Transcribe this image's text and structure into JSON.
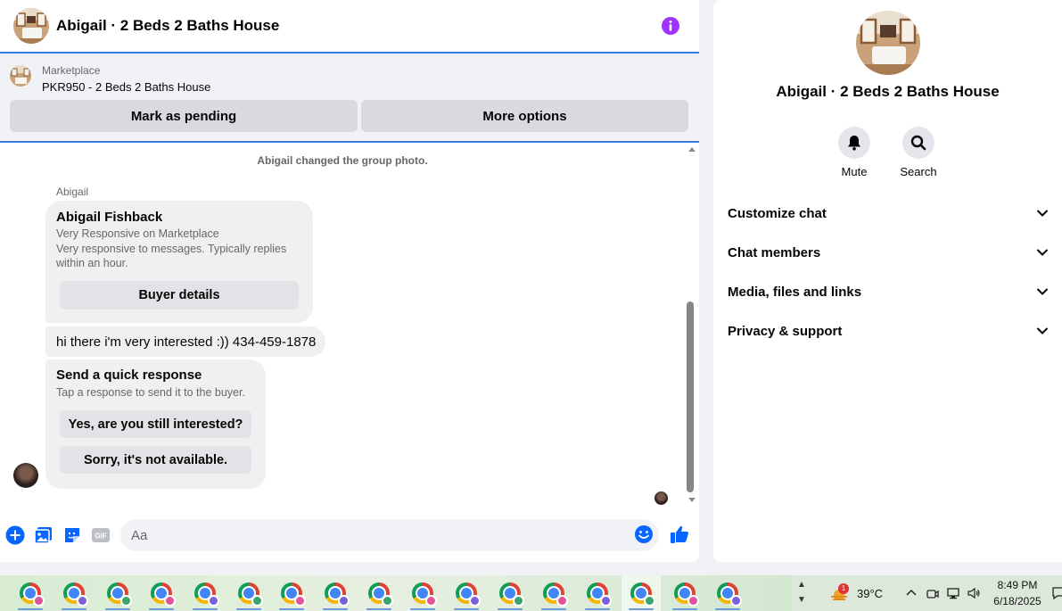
{
  "chat": {
    "title": "Abigail · 2 Beds 2 Baths House",
    "marketplace": {
      "label": "Marketplace",
      "item": "PKR950 - 2 Beds 2 Baths House",
      "mark_pending": "Mark as pending",
      "more_options": "More options"
    },
    "messages": {
      "system_note": "Abigail changed the group photo.",
      "sender": "Abigail",
      "profile_card": {
        "name": "Abigail Fishback",
        "line1": "Very Responsive on Marketplace",
        "line2": "Very responsive to messages. Typically replies within an hour.",
        "button": "Buyer details"
      },
      "text": "hi there i'm very interested :)) 434-459-1878",
      "quick_response": {
        "title": "Send a quick response",
        "subtitle": "Tap a response to send it to the buyer.",
        "option1": "Yes, are you still interested?",
        "option2": "Sorry, it's not available."
      }
    },
    "composer": {
      "placeholder": "Aa",
      "icons": [
        "plus-icon",
        "photo-icon",
        "sticker-icon",
        "gif-icon",
        "emoji-icon",
        "like-icon"
      ]
    },
    "accent_color": "#0866ff",
    "info_icon_color": "#a033ff"
  },
  "info_panel": {
    "title": "Abigail · 2 Beds 2 Baths House",
    "actions": {
      "mute": "Mute",
      "search": "Search"
    },
    "sections": [
      "Customize chat",
      "Chat members",
      "Media, files and links",
      "Privacy & support"
    ]
  },
  "taskbar": {
    "app_count": 17,
    "active_app_index": 14,
    "app_icon": "chrome-icon",
    "weather_temp": "39°C",
    "weather_badge": "1",
    "time": "8:49 PM",
    "date": "6/18/2025"
  }
}
